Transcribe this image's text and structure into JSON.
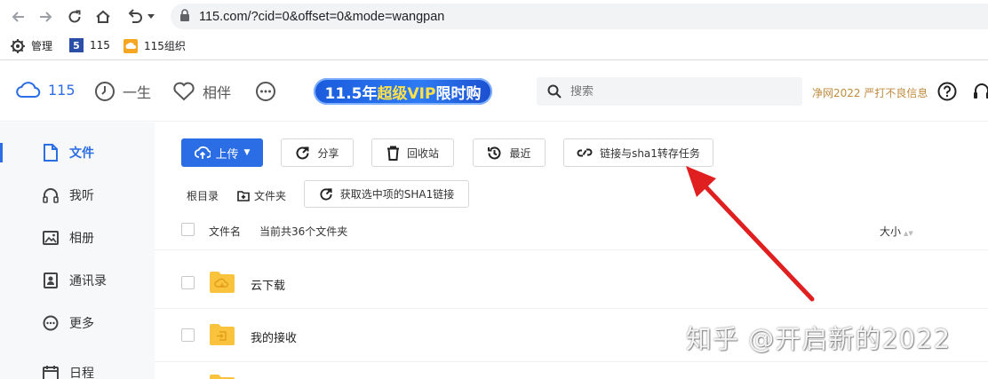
{
  "browser": {
    "url": "115.com/?cid=0&offset=0&mode=wangpan",
    "bookmarks": [
      {
        "label": "管理",
        "icon": "gear-icon"
      },
      {
        "label": "115",
        "icon": "115-logo-icon"
      },
      {
        "label": "115组织",
        "icon": "115-org-icon"
      }
    ]
  },
  "header": {
    "nav": [
      {
        "label": "115",
        "icon": "cloud-icon"
      },
      {
        "label": "一生",
        "icon": "clock-icon"
      },
      {
        "label": "相伴",
        "icon": "heart-icon"
      }
    ],
    "vip_banner": {
      "part1": "11.5年",
      "part2": "超级VIP",
      "part3": "限时购"
    },
    "search_placeholder": "搜索",
    "notice": "净网2022 严打不良信息"
  },
  "sidebar": {
    "items": [
      {
        "label": "文件",
        "icon": "file-icon",
        "active": true
      },
      {
        "label": "我听",
        "icon": "headphones-icon",
        "active": false
      },
      {
        "label": "相册",
        "icon": "image-icon",
        "active": false
      },
      {
        "label": "通讯录",
        "icon": "contacts-icon",
        "active": false
      },
      {
        "label": "更多",
        "icon": "more-icon",
        "active": false
      },
      {
        "label": "日程",
        "icon": "calendar-icon",
        "active": false
      }
    ]
  },
  "toolbar": {
    "upload": "上传",
    "share": "分享",
    "recycle": "回收站",
    "recent": "最近",
    "link_task": "链接与sha1转存任务"
  },
  "breadcrumb": {
    "root": "根目录",
    "new_folder": "文件夹",
    "get_sha1": "获取选中项的SHA1链接"
  },
  "list": {
    "col_name": "文件名",
    "summary": "当前共36个文件夹",
    "col_size": "大小",
    "rows": [
      {
        "name": "云下载",
        "icon": "cloud-download-folder-icon"
      },
      {
        "name": "我的接收",
        "icon": "inbox-folder-icon"
      }
    ]
  },
  "watermark": "知乎 @开启新的2022",
  "colors": {
    "accent": "#2b6de5",
    "folder": "#f9c33d",
    "annotation_arrow": "#e02020"
  }
}
